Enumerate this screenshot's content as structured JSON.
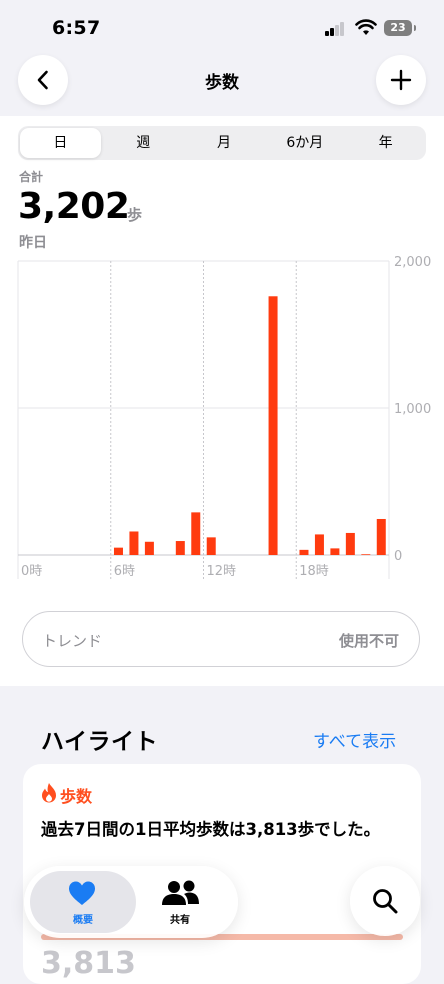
{
  "status": {
    "time": "6:57",
    "battery": "23"
  },
  "nav": {
    "title": "歩数"
  },
  "segments": [
    "日",
    "週",
    "月",
    "6か月",
    "年"
  ],
  "summary": {
    "label": "合計",
    "value": "3,202",
    "unit": "歩",
    "date": "昨日"
  },
  "chart_data": {
    "type": "bar",
    "x": [
      0,
      1,
      2,
      3,
      4,
      5,
      6,
      7,
      8,
      9,
      10,
      11,
      12,
      13,
      14,
      15,
      16,
      17,
      18,
      19,
      20,
      21,
      22,
      23
    ],
    "values": [
      0,
      0,
      0,
      0,
      0,
      0,
      50,
      160,
      90,
      0,
      95,
      290,
      120,
      0,
      0,
      0,
      1760,
      0,
      35,
      140,
      45,
      150,
      5,
      245
    ],
    "y_ticks": [
      "2,000",
      "1,000",
      "0"
    ],
    "x_tick_labels": [
      "0時",
      "6時",
      "12時",
      "18時"
    ],
    "ylim": [
      0,
      2000
    ],
    "color": "#ff3b0f"
  },
  "trend": {
    "label": "トレンド",
    "value": "使用不可"
  },
  "highlights": {
    "title": "ハイライト",
    "show_all": "すべて表示",
    "card": {
      "category": "歩数",
      "text": "過去7日間の1日平均歩数は3,813歩でした。",
      "big_number": "3,813"
    }
  },
  "tabs": [
    {
      "label": "概要",
      "icon": "heart-icon",
      "active": true
    },
    {
      "label": "共有",
      "icon": "people-icon",
      "active": false
    }
  ],
  "colors": {
    "accent": "#ff4f1f",
    "link": "#1a7cf3",
    "tab_active": "#1a7cf3"
  }
}
